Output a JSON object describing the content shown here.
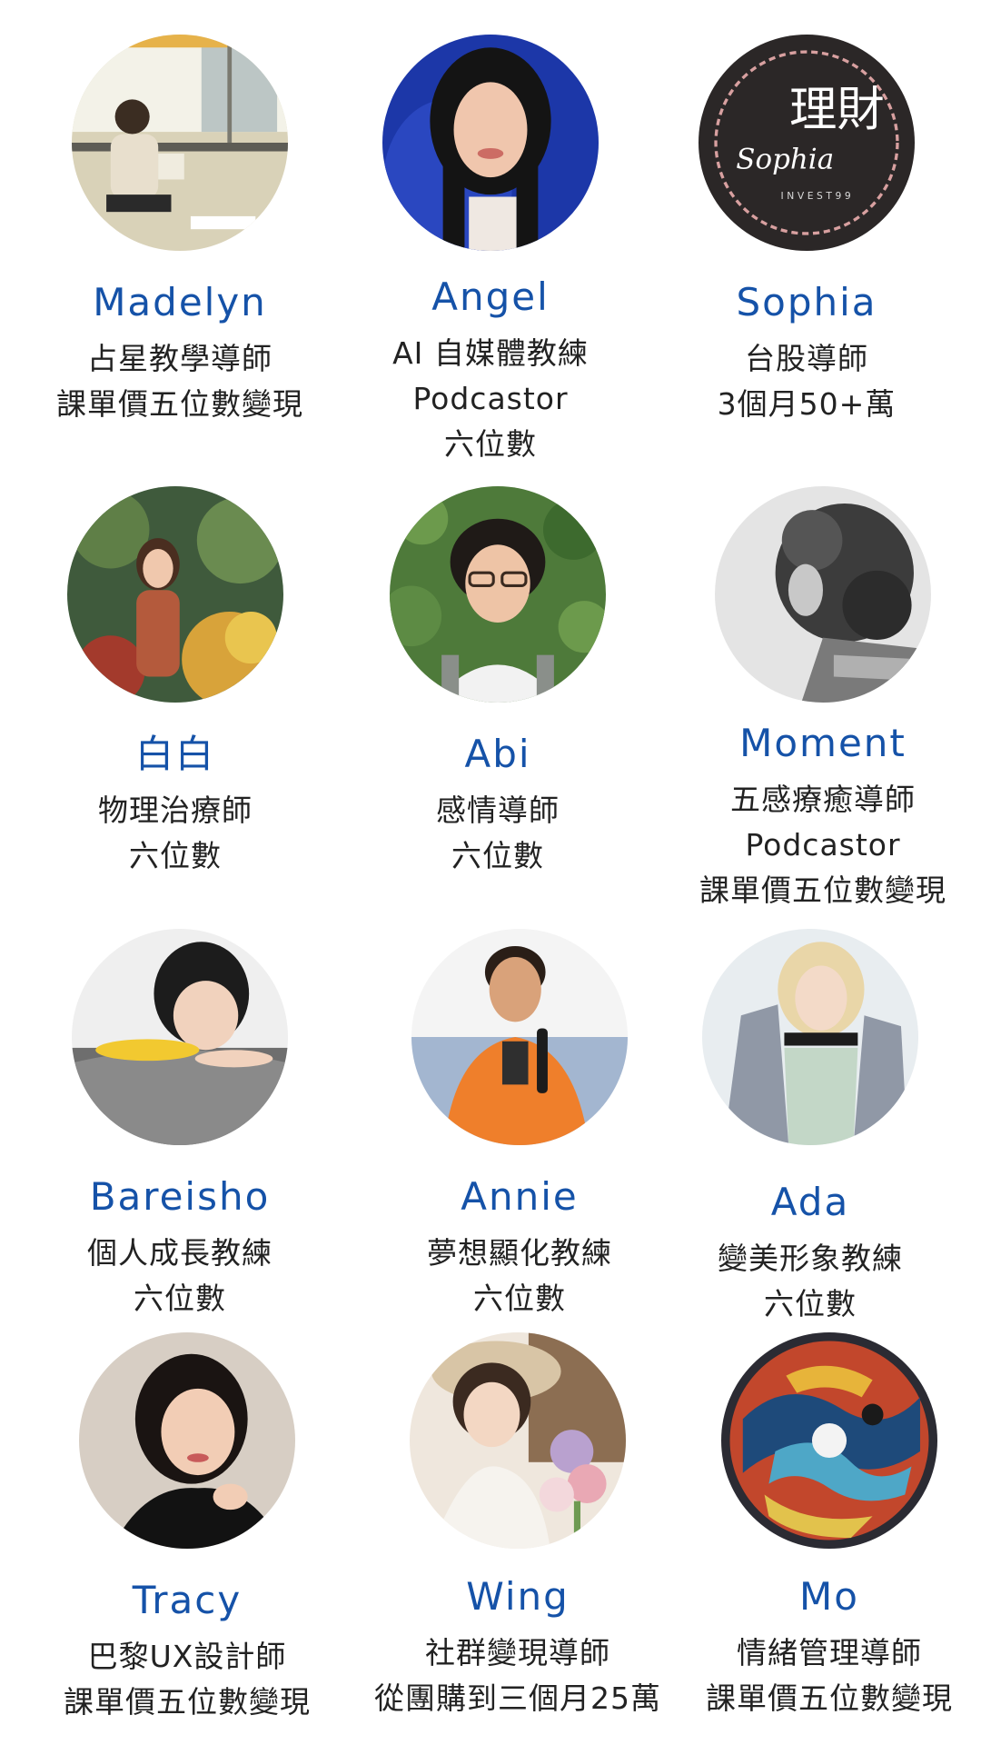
{
  "page": {
    "name_color": "#1552a8"
  },
  "people": [
    {
      "name": "Madelyn",
      "lines": [
        "占星教學導師",
        "課單價五位數變現"
      ]
    },
    {
      "name": "Angel",
      "lines": [
        "AI 自媒體教練",
        "Podcastor",
        "六位數"
      ]
    },
    {
      "name": "Sophia",
      "lines": [
        "台股導師",
        "3個月50+萬"
      ],
      "logo_text": {
        "main": "理財",
        "script": "Sophia",
        "sub": "INVEST99"
      }
    },
    {
      "name": "白白",
      "lines": [
        "物理治療師",
        "六位數"
      ]
    },
    {
      "name": "Abi",
      "lines": [
        "感情導師",
        "六位數"
      ]
    },
    {
      "name": "Moment",
      "lines": [
        "五感療癒導師",
        "Podcastor",
        "課單價五位數變現"
      ]
    },
    {
      "name": "Bareisho",
      "lines": [
        "個人成長教練",
        "六位數"
      ]
    },
    {
      "name": "Annie",
      "lines": [
        "夢想顯化教練",
        "六位數"
      ]
    },
    {
      "name": "Ada",
      "lines": [
        "變美形象教練",
        "六位數"
      ]
    },
    {
      "name": "Tracy",
      "lines": [
        "巴黎UX設計師",
        "課單價五位數變現"
      ]
    },
    {
      "name": "Wing",
      "lines": [
        "社群變現導師",
        "從團購到三個月25萬"
      ]
    },
    {
      "name": "Mo",
      "lines": [
        "情緒管理導師",
        "課單價五位數變現"
      ]
    }
  ]
}
